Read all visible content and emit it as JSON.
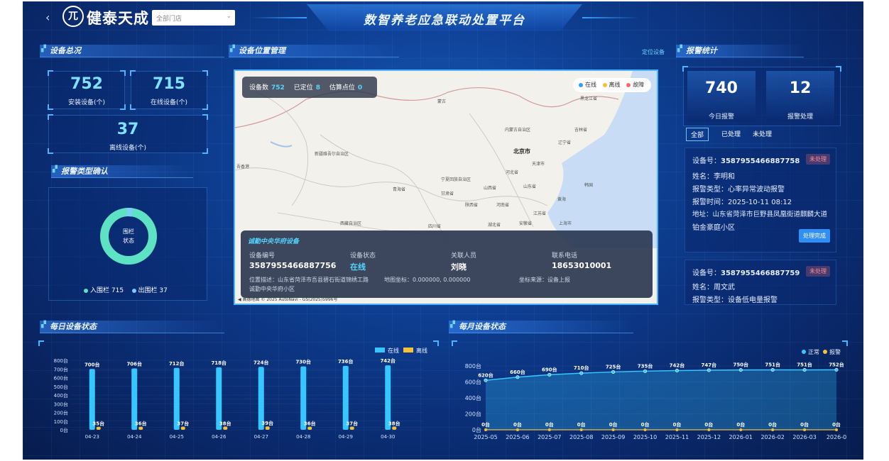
{
  "header": {
    "back_icon": "‹",
    "logo_glyph": "兀",
    "brand": "健泰天成",
    "store_select": "全部门店",
    "title": "数智养老应急联动处置平台"
  },
  "device_overview": {
    "title": "设备总况",
    "installed": {
      "value": "752",
      "label": "安装设备(个)"
    },
    "online": {
      "value": "715",
      "label": "在线设备(个)"
    },
    "offline": {
      "value": "37",
      "label": "离线设备(个)"
    }
  },
  "alarm_type": {
    "title": "报警类型确认",
    "center_label_1": "围栏",
    "center_label_2": "状态",
    "legend": [
      {
        "label": "入围栏",
        "value": "715",
        "color": "#5ee2c4"
      },
      {
        "label": "出围栏",
        "value": "37",
        "color": "#7ecbff"
      }
    ]
  },
  "map": {
    "title": "设备位置管理",
    "link": "定位设备",
    "stats": {
      "devices_label": "设备数",
      "devices": "752",
      "located_label": "已定位",
      "located": "8",
      "estimated_label": "估算点位",
      "estimated": "0"
    },
    "legend": [
      {
        "label": "在线",
        "color": "#2fa0ff"
      },
      {
        "label": "离线",
        "color": "#f5c03a"
      },
      {
        "label": "故障",
        "color": "#f56a6a"
      }
    ],
    "labels": [
      {
        "text": "蒙古"
      },
      {
        "text": "黑龙江省"
      },
      {
        "text": "内蒙古自治区"
      },
      {
        "text": "吉林省"
      },
      {
        "text": "辽宁省"
      },
      {
        "text": "北京市"
      },
      {
        "text": "天津市"
      },
      {
        "text": "河北省"
      },
      {
        "text": "新疆维吾尔自治区"
      },
      {
        "text": "宁夏回族自治区"
      },
      {
        "text": "山西省"
      },
      {
        "text": "山东省"
      },
      {
        "text": "甘肃省"
      },
      {
        "text": "青海省"
      },
      {
        "text": "陕西省"
      },
      {
        "text": "河南省"
      },
      {
        "text": "江苏省"
      },
      {
        "text": "西藏自治区"
      },
      {
        "text": "四川省"
      },
      {
        "text": "湖北省"
      },
      {
        "text": "安徽省"
      },
      {
        "text": "上海市"
      },
      {
        "text": "韩国"
      },
      {
        "text": "黄海"
      },
      {
        "text": "吾香港"
      }
    ],
    "device": {
      "title": "诚勤中央华府设备",
      "id_label": "设备编号",
      "id": "3587955466887756",
      "status_label": "设备状态",
      "status": "在线",
      "person_label": "关联人员",
      "person": "刘晓",
      "phone_label": "联系电话",
      "phone": "18653010001",
      "location": "位置描述：山东省菏泽市吾县碧石街道锦绣工路",
      "coords": "地图坐标：0.000000, 0.000000",
      "source": "坐标来源：设备上报",
      "location_2": "诚勤中央华府小区"
    },
    "attribution": "◀ 高德地图 © 2025 AutoNavi - GS(2025)5996号"
  },
  "alarm_stats": {
    "title": "报警统计",
    "today": {
      "value": "740",
      "label": "今日报警"
    },
    "handled": {
      "value": "12",
      "label": "报警处理"
    },
    "tabs": [
      "全部",
      "已处理",
      "未处理"
    ],
    "cards": [
      {
        "device_label": "设备号：",
        "device": "3587955466887758",
        "badge": "未处理",
        "name": "姓名：李明和",
        "type": "报警类型：心率异常波动报警",
        "time": "报警时间：2025-10-11 08:12",
        "address": "地址：山东省菏泽市巨野县凤凰街道麒麟大道",
        "address_2": "铂金豪庭小区",
        "action": "处理完成"
      },
      {
        "device_label": "设备号：",
        "device": "3587955466887759",
        "badge": "未处理",
        "name": "姓名：周文武",
        "type": "报警类型：设备低电量报警"
      }
    ]
  },
  "daily_chart_title": "每日设备状态",
  "monthly_chart_title": "每月设备状态",
  "chart_data": [
    {
      "type": "bar",
      "categories": [
        "04-23",
        "04-24",
        "04-25",
        "04-26",
        "04-27",
        "04-28",
        "04-29",
        "04-30"
      ],
      "series": [
        {
          "name": "在线",
          "values": [
            700,
            706,
            712,
            718,
            724,
            730,
            736,
            742
          ],
          "labels": [
            "700台",
            "706台",
            "712台",
            "718台",
            "724台",
            "730台",
            "736台",
            "742台"
          ],
          "color": "#36c7ff"
        },
        {
          "name": "离线",
          "values": [
            35,
            36,
            37,
            38,
            39,
            36,
            37,
            38
          ],
          "labels": [
            "35台",
            "36台",
            "37台",
            "38台",
            "39台",
            "36台",
            "37台",
            "38台"
          ],
          "color": "#f5c03a"
        }
      ],
      "yticks": [
        "0台",
        "100台",
        "200台",
        "300台",
        "400台",
        "500台",
        "600台",
        "700台",
        "800台"
      ],
      "ylim": [
        0,
        800
      ]
    },
    {
      "type": "area",
      "x": [
        "2025-05",
        "2025-06",
        "2025-07",
        "2025-08",
        "2025-09",
        "2025-10",
        "2025-11",
        "2025-12",
        "2026-01",
        "2026-02",
        "2026-03",
        "2026-0"
      ],
      "series": [
        {
          "name": "正常",
          "values": [
            620,
            660,
            690,
            710,
            725,
            735,
            742,
            747,
            750,
            751,
            751,
            752
          ],
          "labels": [
            "620台",
            "660台",
            "690台",
            "710台",
            "725台",
            "735台",
            "742台",
            "747台",
            "750台",
            "751台",
            "751台",
            "752台"
          ],
          "color": "#36c7ff"
        },
        {
          "name": "报警",
          "values": [
            0,
            0,
            0,
            0,
            0,
            0,
            0,
            0,
            0,
            0,
            0,
            0
          ],
          "labels": [
            "0台",
            "0台",
            "0台",
            "0台",
            "0台",
            "0台",
            "0台",
            "0台",
            "0台",
            "0台",
            "0台",
            "0台"
          ],
          "color": "#f5c03a"
        }
      ],
      "yticks": [
        "0台",
        "200台",
        "400台",
        "600台",
        "800台"
      ],
      "ylim": [
        0,
        800
      ]
    }
  ]
}
